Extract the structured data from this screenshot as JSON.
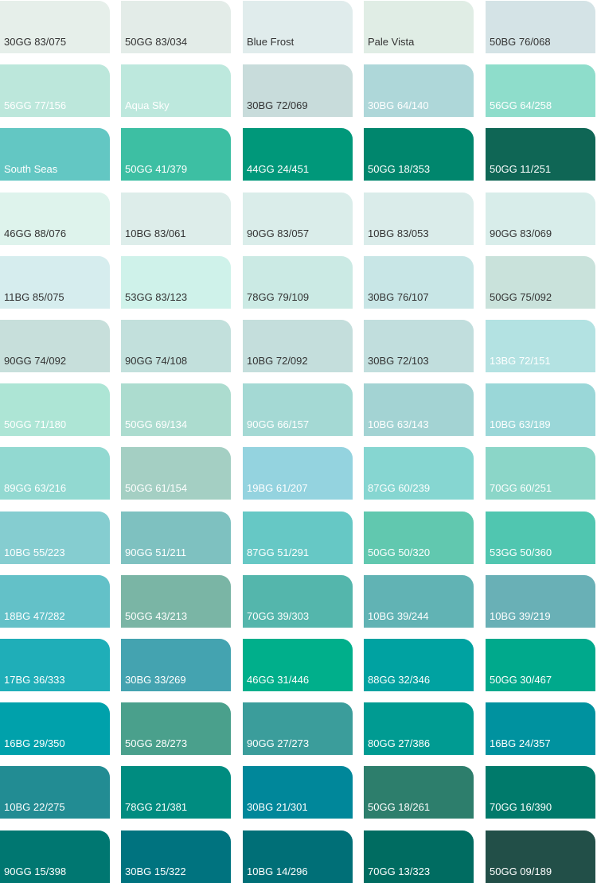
{
  "swatches": [
    {
      "label": "30GG 83/075",
      "color": "#E6EFEA",
      "text": "dark"
    },
    {
      "label": "50GG 83/034",
      "color": "#E3ECE8",
      "text": "dark"
    },
    {
      "label": "Blue Frost",
      "color": "#E0ECEC",
      "text": "dark"
    },
    {
      "label": "Pale Vista",
      "color": "#E0EDE5",
      "text": "dark"
    },
    {
      "label": "50BG 76/068",
      "color": "#D4E3E6",
      "text": "dark"
    },
    {
      "label": "56GG 77/156",
      "color": "#BCE7DB",
      "text": "light"
    },
    {
      "label": "Aqua Sky",
      "color": "#BDE8DD",
      "text": "light"
    },
    {
      "label": "30BG 72/069",
      "color": "#C8DCDB",
      "text": "dark"
    },
    {
      "label": "30BG 64/140",
      "color": "#AED7D9",
      "text": "light"
    },
    {
      "label": "56GG 64/258",
      "color": "#8EDDCB",
      "text": "light"
    },
    {
      "label": "South Seas",
      "color": "#63C7C3",
      "text": "light"
    },
    {
      "label": "50GG 41/379",
      "color": "#3DBFA3",
      "text": "light"
    },
    {
      "label": "44GG 24/451",
      "color": "#00987A",
      "text": "light"
    },
    {
      "label": "50GG 18/353",
      "color": "#00866D",
      "text": "light"
    },
    {
      "label": "50GG 11/251",
      "color": "#0F6655",
      "text": "light"
    },
    {
      "label": "46GG 88/076",
      "color": "#DEF3EC",
      "text": "dark"
    },
    {
      "label": "10BG 83/061",
      "color": "#DDEDEA",
      "text": "dark"
    },
    {
      "label": "90GG 83/057",
      "color": "#DAEDEA",
      "text": "dark"
    },
    {
      "label": "10BG 83/053",
      "color": "#DAECEA",
      "text": "dark"
    },
    {
      "label": "90GG 83/069",
      "color": "#D8EDEA",
      "text": "dark"
    },
    {
      "label": "11BG 85/075",
      "color": "#D6EDEE",
      "text": "dark"
    },
    {
      "label": "53GG 83/123",
      "color": "#CFF2EA",
      "text": "dark"
    },
    {
      "label": "78GG 79/109",
      "color": "#CBEAE4",
      "text": "dark"
    },
    {
      "label": "30BG 76/107",
      "color": "#C8E6E6",
      "text": "dark"
    },
    {
      "label": "50GG 75/092",
      "color": "#C9E2DB",
      "text": "dark"
    },
    {
      "label": "90GG 74/092",
      "color": "#C7DFDB",
      "text": "dark"
    },
    {
      "label": "90GG 74/108",
      "color": "#C2E0DC",
      "text": "dark"
    },
    {
      "label": "10BG 72/092",
      "color": "#C4DEDC",
      "text": "dark"
    },
    {
      "label": "30BG 72/103",
      "color": "#C1DEDD",
      "text": "dark"
    },
    {
      "label": "13BG 72/151",
      "color": "#B3E2E2",
      "text": "light"
    },
    {
      "label": "50GG 71/180",
      "color": "#ADE5D5",
      "text": "light"
    },
    {
      "label": "50GG 69/134",
      "color": "#ACDCCF",
      "text": "light"
    },
    {
      "label": "90GG 66/157",
      "color": "#A4D9D4",
      "text": "light"
    },
    {
      "label": "10BG 63/143",
      "color": "#A3D3D3",
      "text": "light"
    },
    {
      "label": "10BG 63/189",
      "color": "#9AD7D8",
      "text": "light"
    },
    {
      "label": "89GG 63/216",
      "color": "#92D9D1",
      "text": "light"
    },
    {
      "label": "50GG 61/154",
      "color": "#A4CFC3",
      "text": "light"
    },
    {
      "label": "19BG 61/207",
      "color": "#94D3DF",
      "text": "light"
    },
    {
      "label": "87GG 60/239",
      "color": "#86D6D1",
      "text": "light"
    },
    {
      "label": "70GG 60/251",
      "color": "#8BD6C8",
      "text": "light"
    },
    {
      "label": "10BG 55/223",
      "color": "#85CDD0",
      "text": "light"
    },
    {
      "label": "90GG 51/211",
      "color": "#7EC1C0",
      "text": "light"
    },
    {
      "label": "87GG 51/291",
      "color": "#66C8C5",
      "text": "light"
    },
    {
      "label": "50GG 50/320",
      "color": "#61C8AF",
      "text": "light"
    },
    {
      "label": "53GG 50/360",
      "color": "#50C6B0",
      "text": "light"
    },
    {
      "label": "18BG 47/282",
      "color": "#63C1C8",
      "text": "light"
    },
    {
      "label": "50GG 43/213",
      "color": "#7AB5A5",
      "text": "light"
    },
    {
      "label": "70GG 39/303",
      "color": "#54B6AC",
      "text": "light"
    },
    {
      "label": "10BG 39/244",
      "color": "#61B3B4",
      "text": "light"
    },
    {
      "label": "10BG 39/219",
      "color": "#69B0B6",
      "text": "light"
    },
    {
      "label": "17BG 36/333",
      "color": "#1FAEB8",
      "text": "light"
    },
    {
      "label": "30BG 33/269",
      "color": "#44A3B0",
      "text": "light"
    },
    {
      "label": "46GG 31/446",
      "color": "#00AF8B",
      "text": "light"
    },
    {
      "label": "88GG 32/346",
      "color": "#00A2A1",
      "text": "light"
    },
    {
      "label": "50GG 30/467",
      "color": "#00A98C",
      "text": "light"
    },
    {
      "label": "16BG 29/350",
      "color": "#00A1AB",
      "text": "light"
    },
    {
      "label": "50GG 28/273",
      "color": "#4AA08C",
      "text": "light"
    },
    {
      "label": "90GG 27/273",
      "color": "#3B9D9B",
      "text": "light"
    },
    {
      "label": "80GG 27/386",
      "color": "#009B92",
      "text": "light"
    },
    {
      "label": "16BG 24/357",
      "color": "#00929F",
      "text": "light"
    },
    {
      "label": "10BG 22/275",
      "color": "#228C93",
      "text": "light"
    },
    {
      "label": "78GG 21/381",
      "color": "#008C80",
      "text": "light"
    },
    {
      "label": "30BG 21/301",
      "color": "#00879A",
      "text": "light"
    },
    {
      "label": "50GG 18/261",
      "color": "#2D7E6C",
      "text": "light"
    },
    {
      "label": "70GG 16/390",
      "color": "#007A6B",
      "text": "light"
    },
    {
      "label": "90GG 15/398",
      "color": "#007771",
      "text": "light"
    },
    {
      "label": "30BG 15/322",
      "color": "#00737F",
      "text": "light"
    },
    {
      "label": "10BG 14/296",
      "color": "#006F77",
      "text": "light"
    },
    {
      "label": "70GG 13/323",
      "color": "#006C61",
      "text": "light"
    },
    {
      "label": "50GG 09/189",
      "color": "#224F48",
      "text": "light"
    }
  ]
}
